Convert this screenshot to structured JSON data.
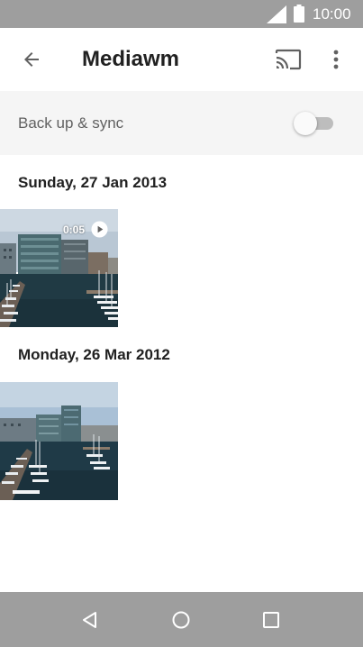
{
  "status_bar": {
    "time": "10:00",
    "icons": [
      "signal-icon",
      "battery-icon"
    ]
  },
  "app_bar": {
    "title": "Mediawm",
    "back_icon": "arrow-back-icon",
    "cast_icon": "cast-icon",
    "overflow_icon": "more-vert-icon"
  },
  "sync": {
    "label": "Back up & sync",
    "enabled": false
  },
  "groups": [
    {
      "date": "Sunday, 27 Jan 2013",
      "items": [
        {
          "type": "video",
          "duration": "0:05",
          "overlay_icon": "play-icon"
        }
      ]
    },
    {
      "date": "Monday, 26 Mar 2012",
      "items": [
        {
          "type": "photo"
        }
      ]
    }
  ],
  "nav_bar": {
    "icons": [
      "nav-back-icon",
      "nav-home-icon",
      "nav-recents-icon"
    ]
  },
  "colors": {
    "status_bar": "#9e9e9e",
    "nav_bar": "#9e9e9e",
    "sync_row_bg": "#f5f5f5",
    "toggle_track": "#bdbdbd"
  }
}
